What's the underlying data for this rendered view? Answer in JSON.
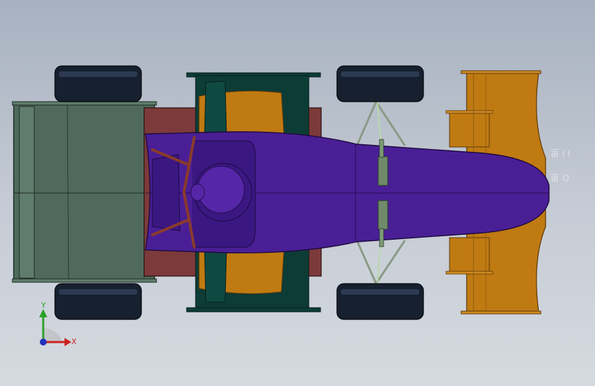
{
  "viewport": {
    "background_top": "#a7b1c0",
    "background_bottom": "#d5dae0"
  },
  "model": {
    "colors": {
      "body_purple": "#4a1f96",
      "body_purple_dark": "#35157a",
      "tire_dark": "#16202e",
      "tire_highlight": "#2c3b52",
      "wing_orange": "#c07a12",
      "wing_orange_dark": "#8e5a0c",
      "sidepod_red": "#7d3a3a",
      "rear_wing_green": "#4f6a5c",
      "sidepod_teal": "#0d3c36",
      "suspension_gray": "#8a9a86",
      "rollbar_brown": "#8a3b2a"
    },
    "annotations": [
      "I I 里",
      "O 里"
    ]
  },
  "triad": {
    "y_label": "Y",
    "x_label": "X",
    "y_color": "#2aa02a",
    "x_color": "#cc2020",
    "z_color": "#2030c0"
  }
}
